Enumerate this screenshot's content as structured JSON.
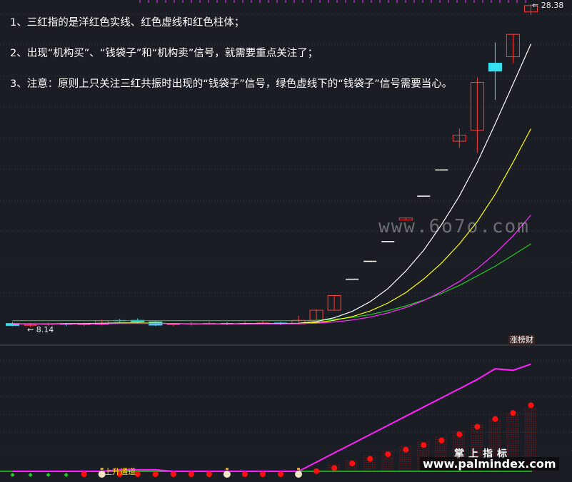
{
  "notes": {
    "line1": "1、三红指的是洋红色实线、红色虚线和红色柱体；",
    "line2": "2、出现“机构买”、“钱袋子”和“机构卖”信号，就需要重点关注了；",
    "line3": "3、注意：原则上只关注三红共振时出现的“钱袋子”信号，绿色虚线下的“钱袋子”信号需要当心。"
  },
  "labels": {
    "high": "28.38",
    "low": "8.14",
    "badge": "涨榜财",
    "channel": "上升通道",
    "watermark_site": "www.6o7o.com",
    "watermark_brand": "掌上指标",
    "watermark_url": "www.palmindex.com"
  },
  "colors": {
    "background": "#1b1d24",
    "up_candle": "#ff3b3b",
    "down_candle": "#36e0f0",
    "flat_candle": "#ffffff",
    "ma_white": "#ffffff",
    "ma_yellow": "#ffff00",
    "ma_magenta": "#ff30ff",
    "ma_green": "#22cc22",
    "indicator_magenta": "#ff20ff",
    "signal_red": "#ff1010",
    "signal_green": "#22cc22"
  },
  "chart_data": [
    {
      "type": "candlestick",
      "title": "",
      "ylim": [
        8.14,
        28.38
      ],
      "annotations": [
        "28.38",
        "8.14"
      ],
      "series": [
        {
          "name": "ohlc",
          "values": [
            [
              8.42,
              8.3,
              8.5,
              8.25
            ],
            [
              8.3,
              8.32,
              8.45,
              8.2
            ],
            [
              8.32,
              8.38,
              8.48,
              8.28
            ],
            [
              8.38,
              8.34,
              8.46,
              8.24
            ],
            [
              8.34,
              8.36,
              8.48,
              8.26
            ],
            [
              8.36,
              8.6,
              8.66,
              8.3
            ],
            [
              8.6,
              8.58,
              8.7,
              8.5
            ],
            [
              8.62,
              8.52,
              8.74,
              8.44
            ],
            [
              8.52,
              8.32,
              8.58,
              8.26
            ],
            [
              8.32,
              8.36,
              8.44,
              8.26
            ],
            [
              8.36,
              8.4,
              8.52,
              8.3
            ],
            [
              8.4,
              8.42,
              8.54,
              8.34
            ],
            [
              8.42,
              8.4,
              8.5,
              8.32
            ],
            [
              8.4,
              8.42,
              8.56,
              8.34
            ],
            [
              8.42,
              8.44,
              8.6,
              8.36
            ],
            [
              8.44,
              8.4,
              8.52,
              8.32
            ],
            [
              8.4,
              8.62,
              8.9,
              8.36
            ],
            [
              8.62,
              9.25,
              9.3,
              8.6
            ],
            [
              9.25,
              10.17,
              10.17,
              9.25
            ],
            [
              11.19,
              11.19,
              11.19,
              11.19
            ],
            [
              12.31,
              12.31,
              12.31,
              12.31
            ],
            [
              13.54,
              13.54,
              13.54,
              13.54
            ],
            [
              14.89,
              15.02,
              15.02,
              14.89
            ],
            [
              16.38,
              16.38,
              16.38,
              16.38
            ],
            [
              18.02,
              18.02,
              18.02,
              18.02
            ],
            [
              19.82,
              20.2,
              20.6,
              19.4
            ],
            [
              20.5,
              23.5,
              23.8,
              19.1
            ],
            [
              24.7,
              24.2,
              26.0,
              22.4
            ],
            [
              25.1,
              26.5,
              26.5,
              24.7
            ],
            [
              27.9,
              28.3,
              28.38,
              27.7
            ]
          ]
        }
      ]
    },
    {
      "type": "line",
      "title": "",
      "series": [
        {
          "name": "",
          "values": [
            8.6,
            8.6,
            8.6,
            8.6,
            8.6,
            8.6,
            8.6,
            8.6,
            8.6,
            8.6,
            8.6,
            8.6,
            8.6,
            8.6,
            8.6,
            8.6,
            8.6,
            8.62,
            8.68,
            8.8,
            8.98,
            9.22,
            9.52,
            9.88,
            10.3,
            10.8,
            11.4,
            12.0,
            12.7,
            13.4
          ]
        },
        {
          "name": "",
          "values": [
            8.4,
            8.4,
            8.4,
            8.42,
            8.42,
            8.44,
            8.46,
            8.46,
            8.44,
            8.42,
            8.4,
            8.4,
            8.4,
            8.42,
            8.42,
            8.42,
            8.44,
            8.55,
            8.78,
            9.18,
            9.78,
            10.6,
            11.7,
            13.0,
            14.6,
            16.4,
            18.5,
            20.9,
            23.4,
            25.9
          ]
        },
        {
          "name": "",
          "values": [
            8.4,
            8.4,
            8.4,
            8.4,
            8.4,
            8.42,
            8.44,
            8.45,
            8.44,
            8.42,
            8.4,
            8.4,
            8.4,
            8.4,
            8.41,
            8.41,
            8.42,
            8.48,
            8.62,
            8.85,
            9.2,
            9.7,
            10.35,
            11.2,
            12.2,
            13.4,
            14.8,
            16.5,
            18.5,
            20.6
          ]
        },
        {
          "name": "",
          "values": [
            8.4,
            8.4,
            8.4,
            8.4,
            8.4,
            8.4,
            8.42,
            8.43,
            8.42,
            8.41,
            8.4,
            8.4,
            8.4,
            8.4,
            8.4,
            8.4,
            8.41,
            8.44,
            8.52,
            8.64,
            8.82,
            9.08,
            9.42,
            9.85,
            10.4,
            11.05,
            11.85,
            12.8,
            13.9,
            15.2
          ]
        }
      ]
    },
    {
      "type": "bar",
      "title": "",
      "series": [
        {
          "name": "",
          "values": [
            0,
            0,
            0,
            0,
            0,
            0,
            0,
            0,
            0,
            0,
            0,
            0,
            0,
            0,
            0,
            0,
            0,
            0,
            4,
            7,
            10,
            13,
            16,
            19,
            22,
            26,
            30,
            34,
            38,
            41
          ]
        },
        {
          "name": "",
          "values": [
            0,
            0,
            0,
            0,
            0,
            0,
            1,
            1,
            1,
            0,
            0,
            0,
            0,
            0,
            0,
            0,
            0,
            6,
            12,
            18,
            24,
            30,
            36,
            42,
            48,
            54,
            60,
            67,
            66,
            70
          ]
        },
        {
          "name": "",
          "values": [
            null,
            null,
            null,
            null,
            0,
            0,
            0,
            0,
            0,
            0,
            0,
            0,
            0,
            0,
            0,
            0,
            0,
            2,
            4,
            7,
            10,
            13,
            16,
            19,
            22,
            26,
            31,
            36,
            40,
            45
          ]
        },
        {
          "name": "",
          "values": [
            0,
            0,
            0,
            0,
            null,
            null,
            null,
            null,
            null,
            null,
            null,
            null,
            null,
            null,
            null,
            null,
            null,
            null,
            null,
            null,
            null,
            null,
            null,
            null,
            null,
            null,
            null,
            null,
            null,
            null
          ]
        }
      ]
    }
  ]
}
